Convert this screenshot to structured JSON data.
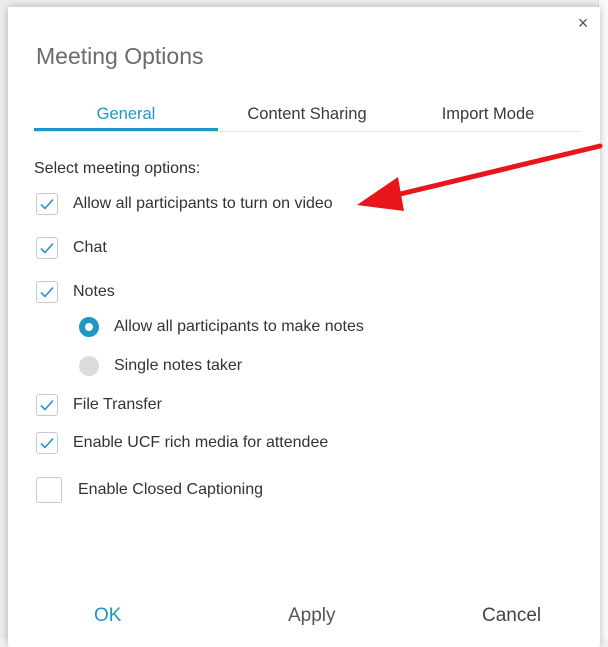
{
  "dialog": {
    "title": "Meeting Options",
    "close_icon": "close-icon"
  },
  "tabs": [
    {
      "label": "General",
      "active": true
    },
    {
      "label": "Content Sharing",
      "active": false
    },
    {
      "label": "Import Mode",
      "active": false
    }
  ],
  "section_label": "Select meeting options:",
  "options": {
    "video": {
      "label": "Allow all participants to turn on video",
      "checked": true
    },
    "chat": {
      "label": "Chat",
      "checked": true
    },
    "notes": {
      "label": "Notes",
      "checked": true
    },
    "file_transfer": {
      "label": "File Transfer",
      "checked": true
    },
    "ucf": {
      "label": "Enable UCF rich media for attendee",
      "checked": true
    },
    "captioning": {
      "label": "Enable Closed Captioning",
      "checked": false
    }
  },
  "notes_mode": {
    "all": {
      "label": "Allow all participants to make notes",
      "selected": true
    },
    "single": {
      "label": "Single notes taker",
      "selected": false
    }
  },
  "footer": {
    "ok": "OK",
    "apply": "Apply",
    "cancel": "Cancel"
  },
  "colors": {
    "accent": "#1f97c6",
    "arrow": "#e8161a"
  }
}
